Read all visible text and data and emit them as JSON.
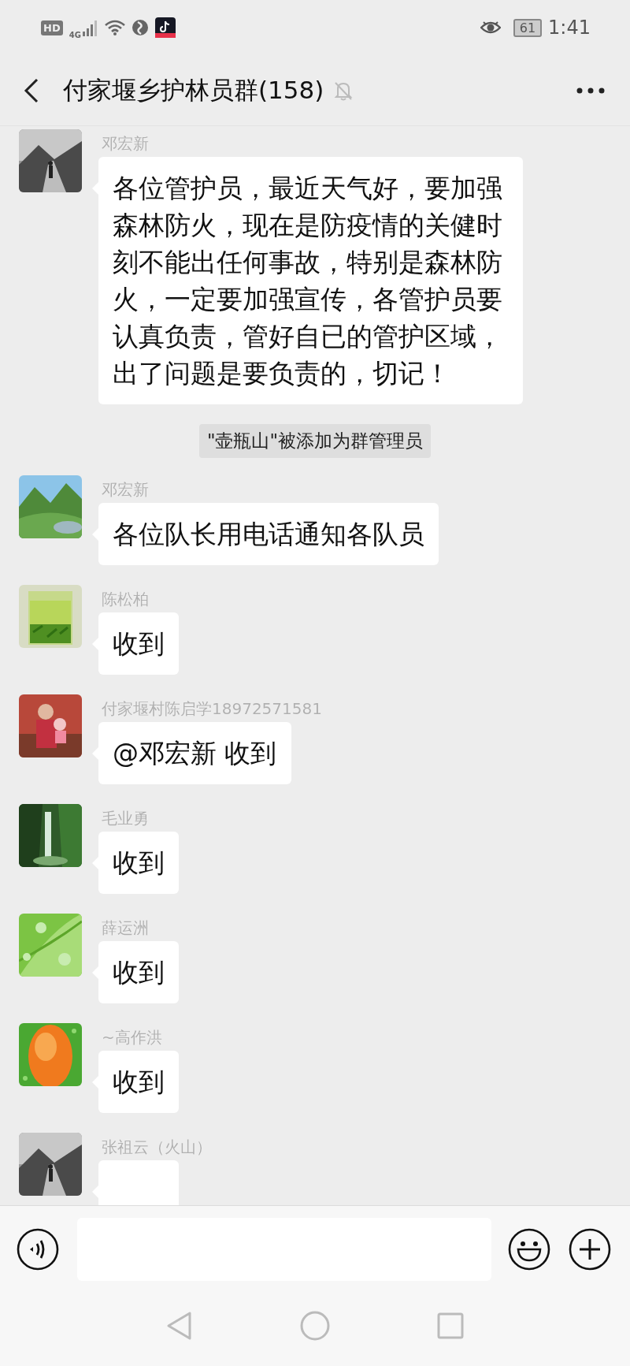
{
  "status_bar": {
    "hd": "HD",
    "network": "4G",
    "battery": "61",
    "time": "1:41"
  },
  "header": {
    "title": "付家堰乡护林员群(158)",
    "muted": true
  },
  "messages": [
    {
      "kind": "text",
      "sender": "邓宏新",
      "text": "各位管护员，最近天气好，要加强森林防火，现在是防疫情的关健时刻不能出任何事故，特别是森林防火，一定要加强宣传，各管护员要认真负责，管好自已的管护区域，出了问题是要负责的，切记！"
    },
    {
      "kind": "system",
      "text": "\"壶瓶山\"被添加为群管理员"
    },
    {
      "kind": "text",
      "sender": "邓宏新",
      "text": "各位队长用电话通知各队员"
    },
    {
      "kind": "text",
      "sender": "陈松柏",
      "text": "收到"
    },
    {
      "kind": "text",
      "sender": "付家堰村陈启学18972571581",
      "text": "@邓宏新  收到"
    },
    {
      "kind": "text",
      "sender": "毛业勇",
      "text": "收到"
    },
    {
      "kind": "text",
      "sender": "薛运洲",
      "text": "收到"
    },
    {
      "kind": "text",
      "sender": "~高作洪",
      "text": "收到"
    },
    {
      "kind": "text",
      "sender": "张祖云（火山）"
    }
  ]
}
